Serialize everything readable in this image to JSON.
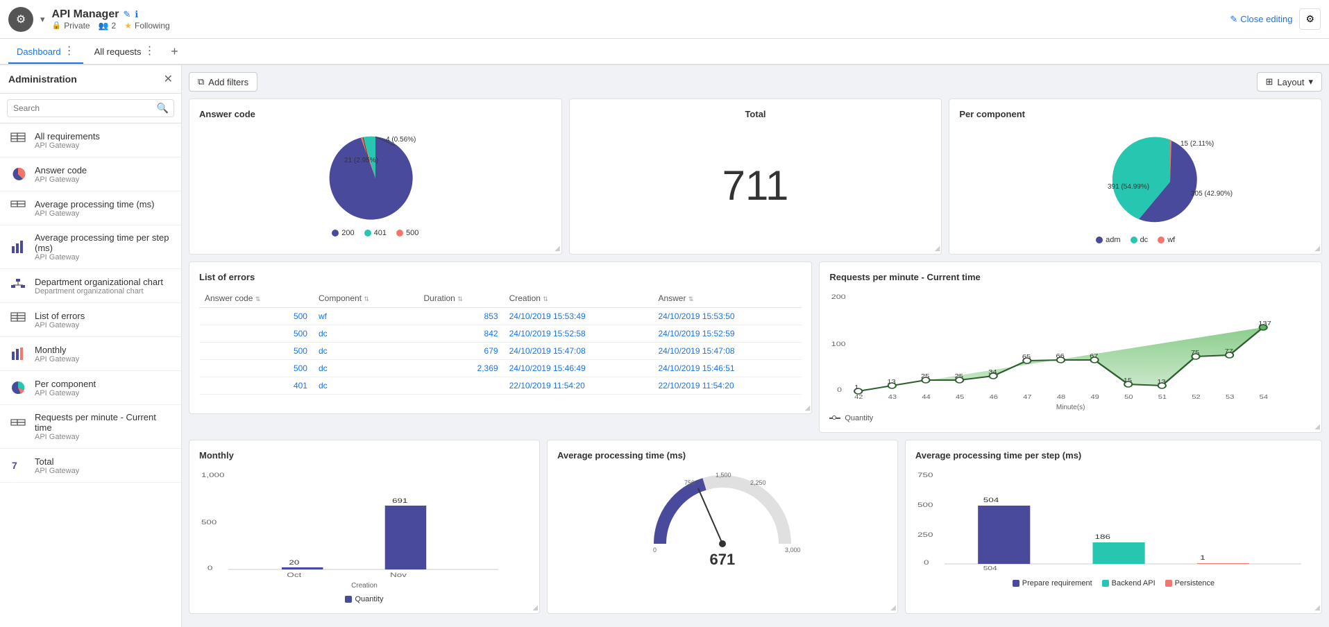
{
  "header": {
    "app_icon": "⚙",
    "app_title": "API Manager",
    "pencil_icon": "✎",
    "info_icon": "ℹ",
    "private_label": "Private",
    "users_count": "2",
    "following_label": "Following",
    "close_editing_label": "Close editing",
    "settings_icon": "⚙"
  },
  "tabs": [
    {
      "label": "Dashboard",
      "active": true
    },
    {
      "label": "All requests",
      "active": false
    }
  ],
  "sidebar": {
    "title": "Administration",
    "close_icon": "✕",
    "search_placeholder": "Search",
    "items": [
      {
        "name": "All requirements",
        "sub": "API Gateway",
        "icon": "table"
      },
      {
        "name": "Answer code",
        "sub": "API Gateway",
        "icon": "pie"
      },
      {
        "name": "Average processing time (ms)",
        "sub": "API Gateway",
        "icon": "table"
      },
      {
        "name": "Average processing time per step (ms)",
        "sub": "API Gateway",
        "icon": "bar"
      },
      {
        "name": "Department organizational chart",
        "sub": "Department organizational chart",
        "icon": "org"
      },
      {
        "name": "List of errors",
        "sub": "API Gateway",
        "icon": "table"
      },
      {
        "name": "Monthly",
        "sub": "API Gateway",
        "icon": "bar"
      },
      {
        "name": "Per component",
        "sub": "API Gateway",
        "icon": "pie"
      },
      {
        "name": "Requests per minute - Current time",
        "sub": "API Gateway",
        "icon": "table"
      },
      {
        "name": "Total",
        "sub": "API Gateway",
        "icon": "number"
      }
    ]
  },
  "filter_bar": {
    "add_filters_label": "Add filters",
    "layout_label": "Layout"
  },
  "cards": {
    "answer_code": {
      "title": "Answer code",
      "segments": [
        {
          "label": "200",
          "color": "#4a4a9c",
          "value": 96.49,
          "annotation": ""
        },
        {
          "label": "401",
          "color": "#26c6b0",
          "value": 2.95,
          "annotation": "21 (2.95%)"
        },
        {
          "label": "500",
          "color": "#f4766b",
          "value": 0.56,
          "annotation": "4 (0.56%)"
        }
      ]
    },
    "total": {
      "title": "Total",
      "value": "711"
    },
    "per_component": {
      "title": "Per component",
      "segments": [
        {
          "label": "adm",
          "color": "#4a4a9c",
          "value": 54.99,
          "annotation": "391 (54.99%)"
        },
        {
          "label": "dc",
          "color": "#26c6b0",
          "value": 42.9,
          "annotation": "305 (42.90%)"
        },
        {
          "label": "wf",
          "color": "#f4766b",
          "value": 2.11,
          "annotation": "15 (2.11%)"
        }
      ]
    },
    "list_of_errors": {
      "title": "List of errors",
      "columns": [
        "Answer code",
        "Component",
        "Duration",
        "Creation",
        "Answer"
      ],
      "rows": [
        {
          "code": "500",
          "component": "wf",
          "duration": "853",
          "creation": "24/10/2019 15:53:49",
          "answer": "24/10/2019 15:53:50"
        },
        {
          "code": "500",
          "component": "dc",
          "duration": "842",
          "creation": "24/10/2019 15:52:58",
          "answer": "24/10/2019 15:52:59"
        },
        {
          "code": "500",
          "component": "dc",
          "duration": "679",
          "creation": "24/10/2019 15:47:08",
          "answer": "24/10/2019 15:47:08"
        },
        {
          "code": "500",
          "component": "dc",
          "duration": "2,369",
          "creation": "24/10/2019 15:46:49",
          "answer": "24/10/2019 15:46:51"
        },
        {
          "code": "401",
          "component": "dc",
          "duration": "",
          "creation": "22/10/2019 11:54:20",
          "answer": "22/10/2019 11:54:20"
        }
      ]
    },
    "rpm": {
      "title": "Requests per minute - Current time",
      "y_max": 200,
      "y_labels": [
        "200",
        "100",
        "0"
      ],
      "x_labels": [
        "42",
        "43",
        "44",
        "45",
        "46",
        "47",
        "48",
        "49",
        "50",
        "51",
        "52",
        "53",
        "54"
      ],
      "x_axis_label": "Minute(s)",
      "y_axis_label": "Quantity",
      "data_points": [
        1,
        13,
        25,
        25,
        34,
        65,
        66,
        67,
        15,
        13,
        75,
        77,
        137
      ],
      "legend_label": "Quantity"
    },
    "monthly": {
      "title": "Monthly",
      "y_labels": [
        "1,000",
        "500",
        "0"
      ],
      "x_labels": [
        "Oct",
        "Nov"
      ],
      "x_axis_label": "Creation",
      "bars": [
        {
          "label": "Oct",
          "value": 20,
          "color": "#4a4a9c"
        },
        {
          "label": "Nov",
          "value": 691,
          "color": "#4a4a9c"
        }
      ],
      "legend_label": "Quantity",
      "y_max": 1000
    },
    "avg_proc": {
      "title": "Average processing time (ms)",
      "value": "671",
      "min": "0",
      "max": "3,000",
      "mid_left": "750",
      "mid_right": "2,250",
      "top": "1,500"
    },
    "avg_step": {
      "title": "Average processing time per step (ms)",
      "y_labels": [
        "750",
        "500",
        "250",
        "0"
      ],
      "bars": [
        {
          "label": "Prepare requirement",
          "value": 504,
          "color": "#4a4a9c"
        },
        {
          "label": "Backend API",
          "value": 186,
          "color": "#26c6b0"
        },
        {
          "label": "Persistence",
          "value": 1,
          "color": "#f4766b"
        }
      ],
      "y_max": 750,
      "legend": [
        "Prepare requirement",
        "Backend API",
        "Persistence"
      ],
      "legend_colors": [
        "#4a4a9c",
        "#26c6b0",
        "#f4766b"
      ],
      "x_labels": [
        "504"
      ]
    }
  }
}
